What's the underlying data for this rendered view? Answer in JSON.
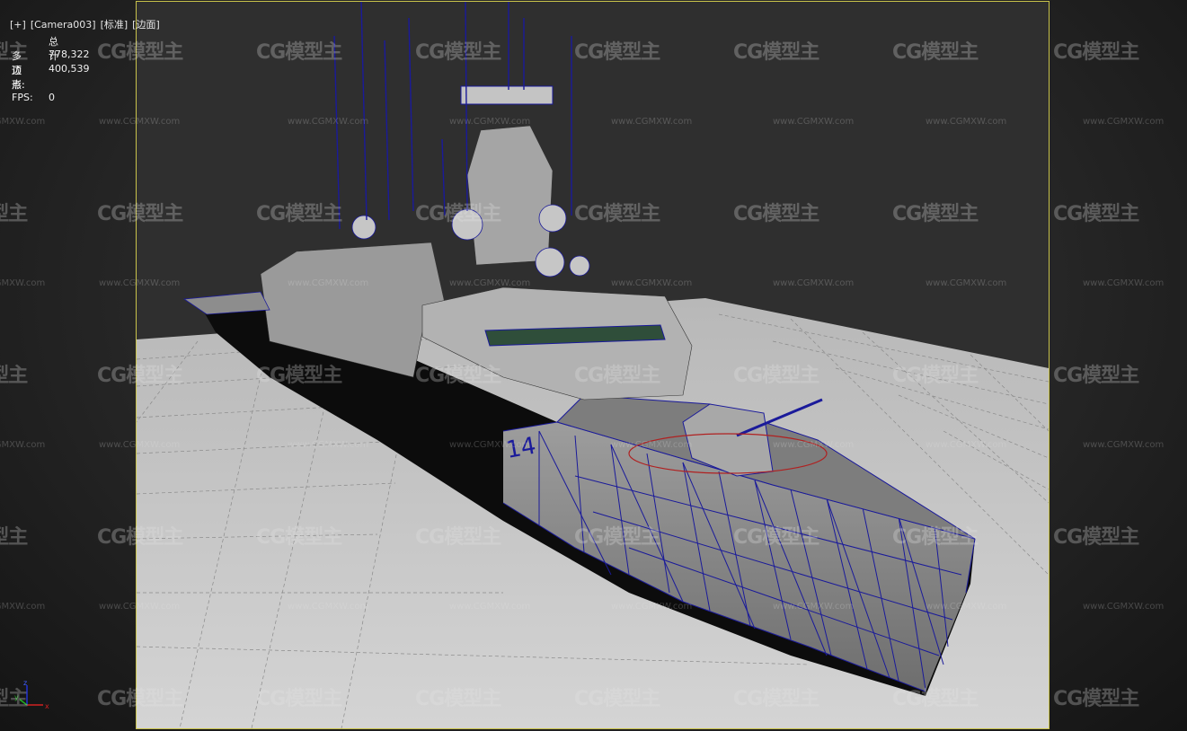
{
  "viewport": {
    "label_items": [
      "[+]",
      "[Camera003]",
      "[标准]",
      "[边面]"
    ]
  },
  "stats": {
    "header": "总计",
    "polygons_label": "多边形:",
    "polygons_value": "778,322",
    "vertices_label": "顶点:",
    "vertices_value": "400,539",
    "fps_label": "FPS:",
    "fps_value": "0"
  },
  "ship": {
    "hull_number": "14"
  },
  "axis_gizmo": {
    "x": "x",
    "y": "y",
    "z": "z"
  },
  "watermark": {
    "logo_text": "CG模型主",
    "url_text": "www.CGMXW.com"
  },
  "colors": {
    "safe_frame": "#c8c24a",
    "wireframe": "#1a1a9a",
    "ground": "#cfcfcf",
    "ship_body": "#a9a9a9"
  }
}
